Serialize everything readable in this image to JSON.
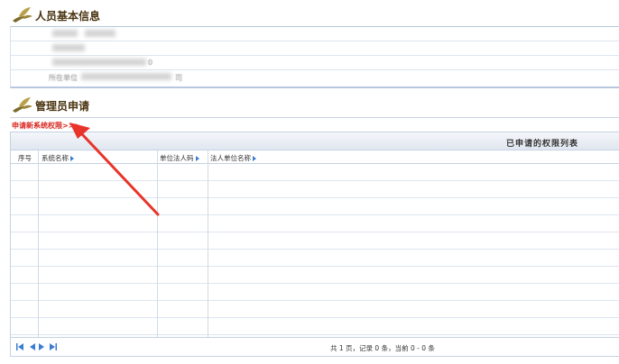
{
  "section_basic": {
    "title": "人员基本信息",
    "icon": "bird-logo-icon"
  },
  "info_rows": {
    "row4_label": "所在单位",
    "row3_tail": "0",
    "row4_tail": "司"
  },
  "section_admin": {
    "title": "管理员申请",
    "icon": "bird-logo-icon"
  },
  "apply_link": "申请新系统权限>>>",
  "table": {
    "title": "已申请的权限列表",
    "columns": [
      "序号",
      "系统名称",
      "单位法人码",
      "法人单位名称"
    ],
    "rows": []
  },
  "pager": {
    "icons": [
      "first-page-icon",
      "prev-page-icon",
      "next-page-icon",
      "last-page-icon"
    ],
    "info": "共 1 页，记录 0 条，当前 0 - 0 条"
  },
  "colors": {
    "accent_red": "#d8261f",
    "link_red": "#d8261f",
    "border_blue": "#c5d2e3",
    "sort_blue": "#3c7dd0",
    "title_brown": "#4a3410"
  }
}
